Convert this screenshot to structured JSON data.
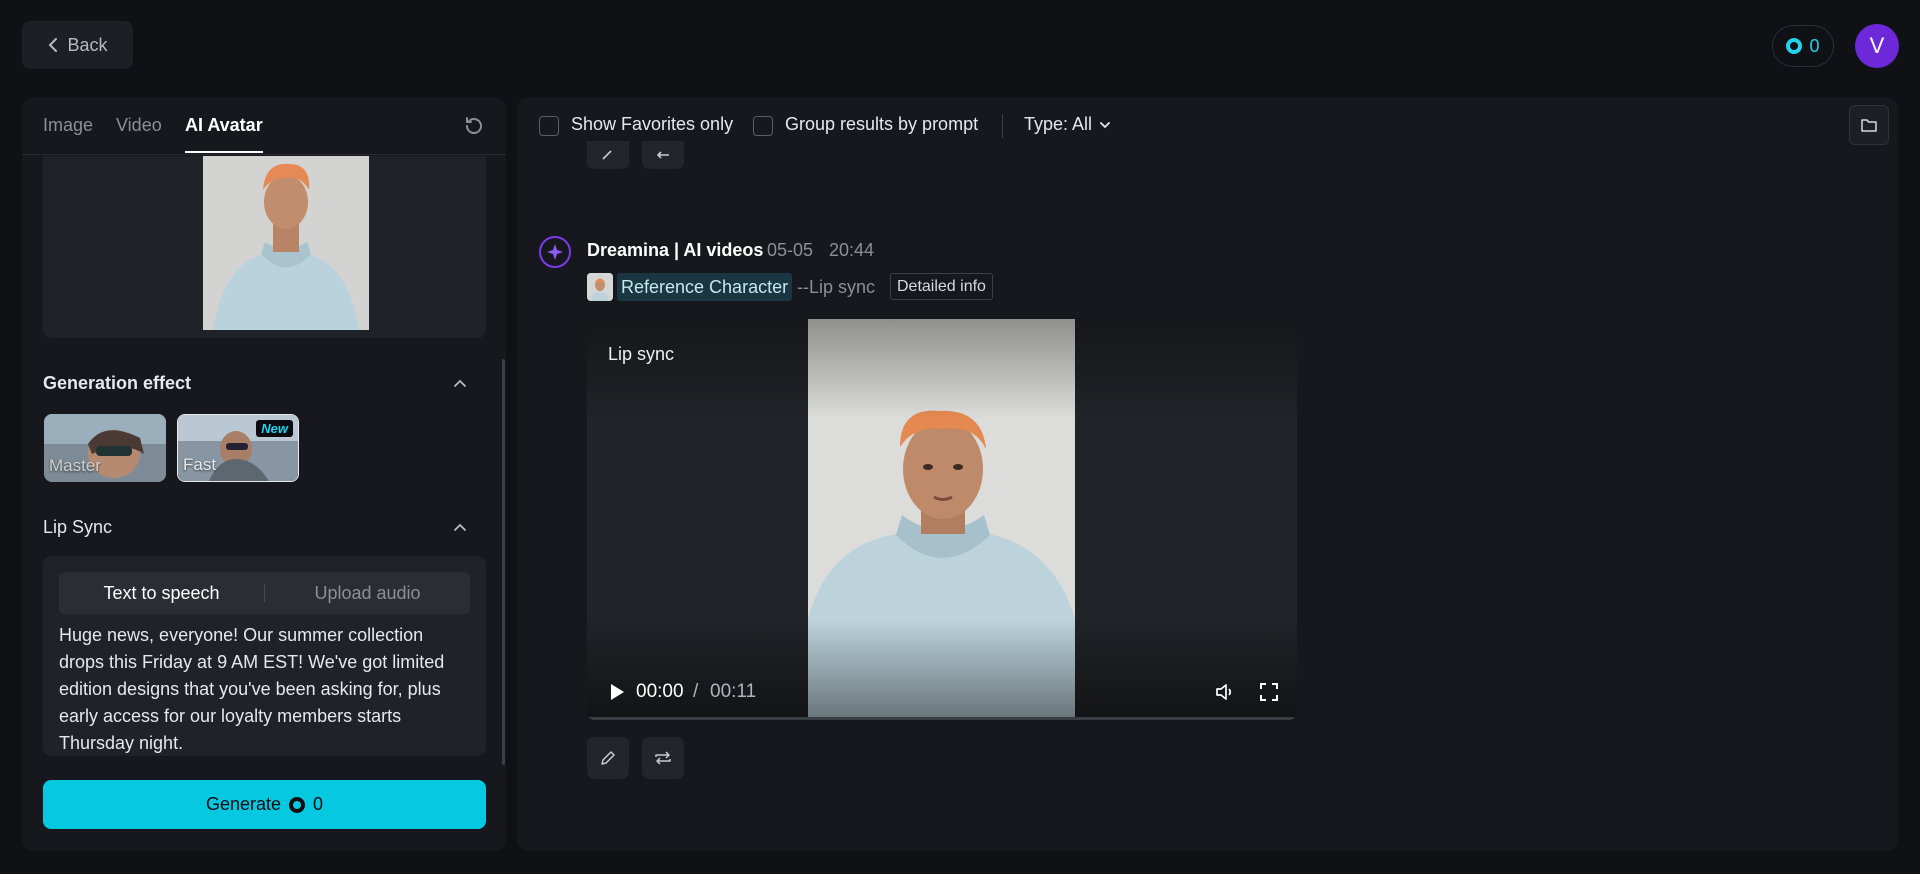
{
  "topbar": {
    "back_label": "Back",
    "credits": "0",
    "avatar_initial": "V"
  },
  "left_panel": {
    "tabs": [
      {
        "label": "Image",
        "active": false
      },
      {
        "label": "Video",
        "active": false
      },
      {
        "label": "AI Avatar",
        "active": true
      }
    ],
    "generation_effect": {
      "title": "Generation effect",
      "options": [
        {
          "label": "Master",
          "selected": false
        },
        {
          "label": "Fast",
          "selected": true,
          "badge": "New"
        }
      ]
    },
    "lip_sync": {
      "title": "Lip Sync",
      "modes": [
        "Text to speech",
        "Upload audio"
      ],
      "active_mode": "Text to speech",
      "text": "Huge news, everyone! Our summer collection drops this Friday at 9 AM EST! We've got limited edition designs that you've been asking for, plus early access for our loyalty members starts Thursday night."
    },
    "generate": {
      "label": "Generate",
      "cost": "0"
    }
  },
  "right_panel": {
    "filters": {
      "favorites_label": "Show Favorites only",
      "group_label": "Group results by prompt",
      "type_label": "Type: All"
    },
    "entry": {
      "title": "Dreamina | AI videos",
      "date": "05-05",
      "time": "20:44",
      "reference_label": "Reference Character",
      "mode_tag": "--Lip sync",
      "detail_label": "Detailed info",
      "video": {
        "label": "Lip sync",
        "current_time": "00:00",
        "separator": "/",
        "total_time": "00:11",
        "progress": 0
      }
    }
  },
  "colors": {
    "accent": "#06c8e0",
    "background": "#0f1115",
    "panel": "#16181d",
    "avatar": "#6d28d9"
  }
}
